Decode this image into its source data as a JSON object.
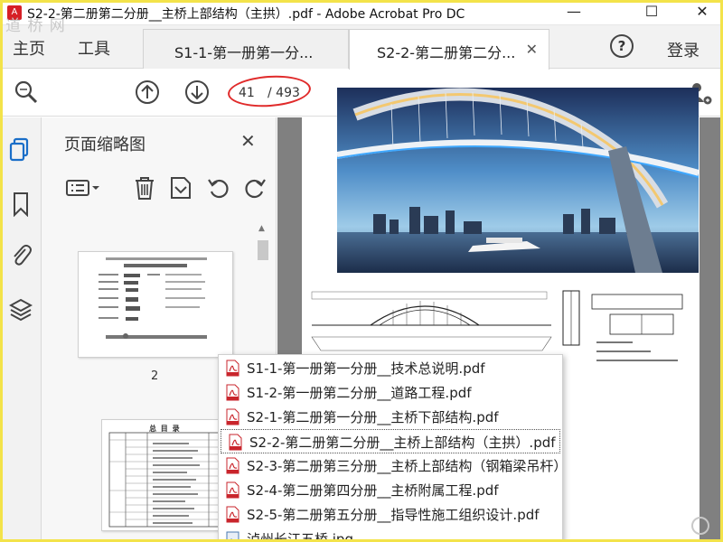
{
  "window": {
    "title": "S2-2-第二册第二分册__主桥上部结构（主拱）.pdf - Adobe Acrobat Pro DC",
    "app_icon_text": "A",
    "minimize": "—",
    "maximize": "☐",
    "close": "✕"
  },
  "watermark": "道 桥 网",
  "tabbar": {
    "home": "主页",
    "tools": "工具",
    "tabs": [
      {
        "label": "S1-1-第一册第一分...",
        "active": false
      },
      {
        "label": "S2-2-第二册第二分...",
        "active": true
      }
    ],
    "tab_close": "✕",
    "help": "?",
    "login": "登录"
  },
  "toolbar": {
    "page_current": "41",
    "page_total": "/ 493"
  },
  "panel": {
    "title": "页面缩略图",
    "close": "✕",
    "thumbnails": [
      {
        "page_number": "2"
      },
      {
        "heading": "总 目 录"
      }
    ]
  },
  "dropdown": {
    "items": [
      {
        "label": "S1-1-第一册第一分册__技术总说明.pdf",
        "icon": "pdf-icon"
      },
      {
        "label": "S1-2-第一册第二分册__道路工程.pdf",
        "icon": "pdf-icon"
      },
      {
        "label": "S2-1-第二册第一分册__主桥下部结构.pdf",
        "icon": "pdf-icon"
      },
      {
        "label": "S2-2-第二册第二分册__主桥上部结构（主拱）.pdf",
        "icon": "pdf-icon",
        "highlighted": true
      },
      {
        "label": "S2-3-第二册第三分册__主桥上部结构（钢箱梁吊杆）",
        "icon": "pdf-icon"
      },
      {
        "label": "S2-4-第二册第四分册__主桥附属工程.pdf",
        "icon": "pdf-icon"
      },
      {
        "label": "S2-5-第二册第五分册__指导性施工组织设计.pdf",
        "icon": "pdf-icon"
      },
      {
        "label": "泸州长江五桥.jpg",
        "icon": "image-icon"
      }
    ]
  },
  "colors": {
    "annotation_red": "#e02a2a",
    "acrobat_red": "#d61f26",
    "accent_blue": "#1a6ec8",
    "frame_yellow": "#f3e34a"
  }
}
